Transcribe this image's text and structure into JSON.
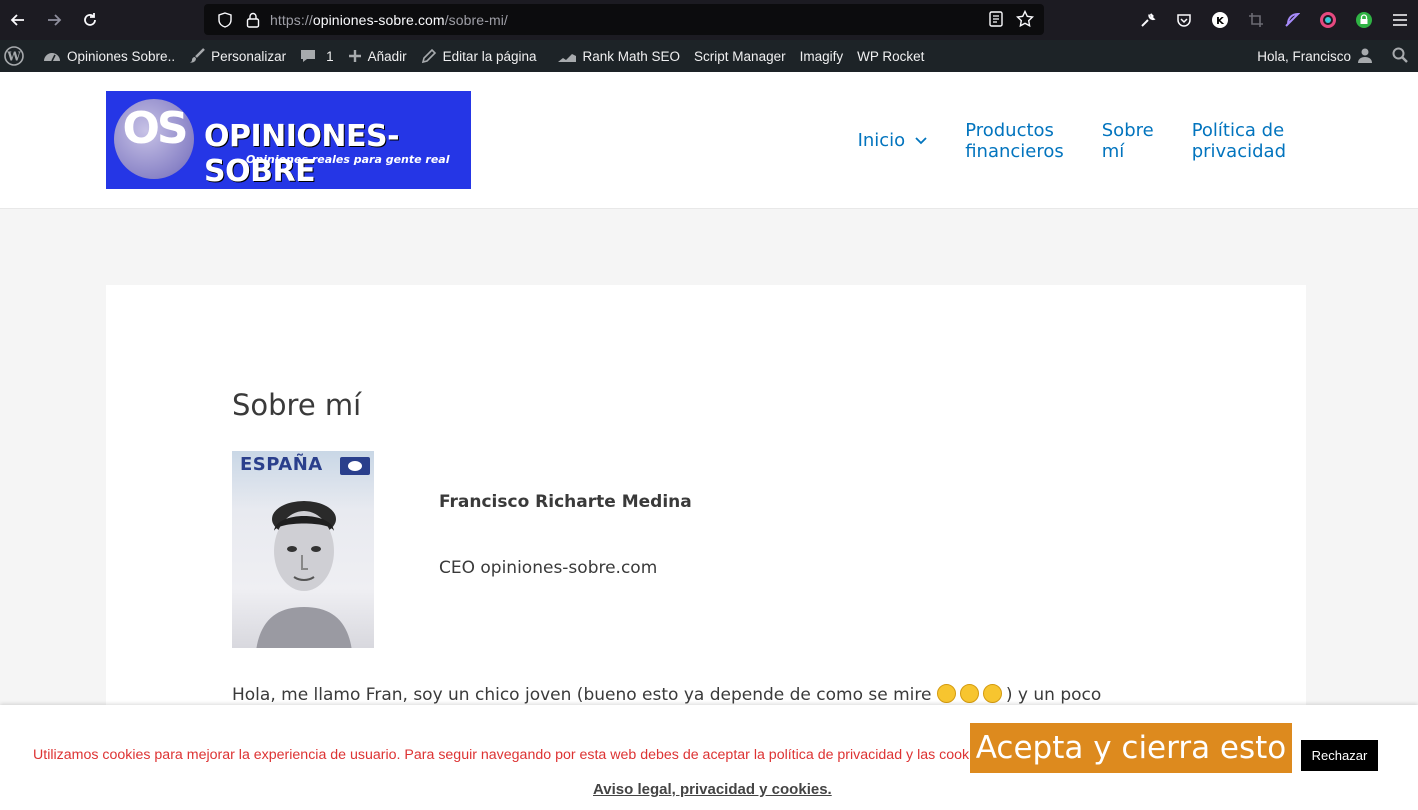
{
  "browser": {
    "url_scheme": "https://",
    "url_host": "opiniones-sobre.com",
    "url_path": "/sobre-mi/"
  },
  "adminbar": {
    "site_name": "Opiniones Sobre..",
    "customize": "Personalizar",
    "comments_count": "1",
    "add_new": "Añadir",
    "edit_page": "Editar la página",
    "rank_math": "Rank Math SEO",
    "script_manager": "Script Manager",
    "imagify": "Imagify",
    "wp_rocket": "WP Rocket",
    "greeting": "Hola, Francisco"
  },
  "logo": {
    "monogram": "OS",
    "brand": "OPINIONES-SOBRE",
    "tagline": "Opiniones reales para gente real"
  },
  "menu": {
    "items": [
      {
        "label": "Inicio"
      },
      {
        "label": "Productos financieros"
      },
      {
        "label": "Sobre mí"
      },
      {
        "label": "Política de privacidad"
      }
    ]
  },
  "page": {
    "title": "Sobre mí",
    "photo_label": "ESPAÑA",
    "author_name": "Francisco Richarte Medina",
    "author_role": "CEO opiniones-sobre.com",
    "intro_before": "Hola, me llamo Fran, soy un chico joven (bueno esto ya depende de como se mire ",
    "intro_after": ") y un poco"
  },
  "cookie": {
    "text": "Utilizamos cookies para mejorar la experiencia de usuario. Para seguir navegando por esta web debes de aceptar la política de privacidad y las cookies.",
    "accept_label": "Acepta y cierra esto",
    "reject_label": "Rechazar",
    "legal_link": "Aviso legal, privacidad y cookies."
  },
  "colors": {
    "link": "#0274be",
    "accept_bg": "#dd8a1e",
    "cookie_text": "#dd3333",
    "logo_bg": "#2536e6"
  }
}
